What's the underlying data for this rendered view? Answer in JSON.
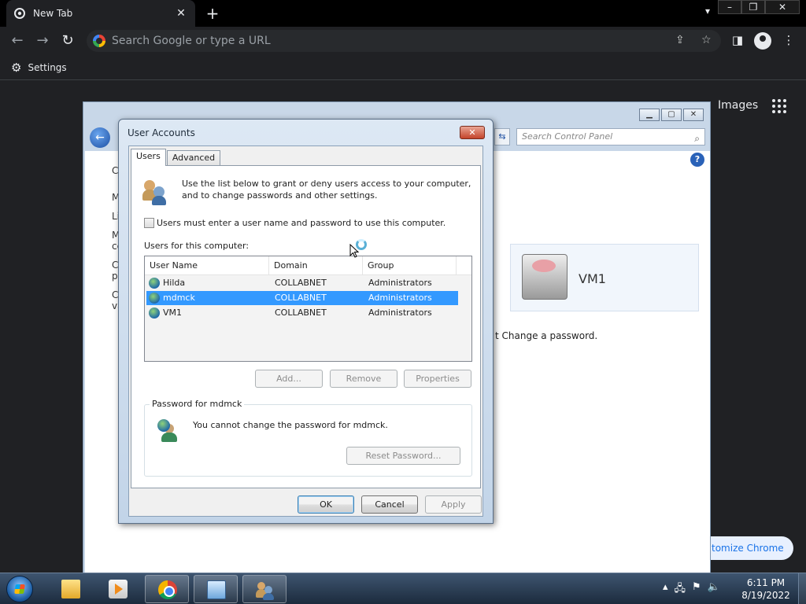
{
  "browser": {
    "tab_title": "New Tab",
    "tab_close": "✕",
    "new_tab": "+",
    "omnibox_placeholder": "Search Google or type a URL",
    "bookmark_settings": "Settings",
    "ntp_images": "Images",
    "customize_chrome": "tomize Chrome"
  },
  "control_panel": {
    "search_placeholder": "Search Control Panel",
    "left_fragments": [
      "C",
      "M",
      "Li",
      "M",
      "ce",
      "C",
      "pr",
      "C",
      "va"
    ],
    "vm1_label": "VM1",
    "change_password_link": "t Change a password."
  },
  "dialog": {
    "title": "User Accounts",
    "tabs": [
      "Users",
      "Advanced"
    ],
    "intro_text": "Use the list below to grant or deny users access to your computer, and to change passwords and other settings.",
    "must_enter_label": "Users must enter a user name and password to use this computer.",
    "users_for_computer_label": "Users for this computer:",
    "columns": [
      "User Name",
      "Domain",
      "Group"
    ],
    "users": [
      {
        "name": "Hilda",
        "domain": "COLLABNET",
        "group": "Administrators"
      },
      {
        "name": "mdmck",
        "domain": "COLLABNET",
        "group": "Administrators"
      },
      {
        "name": "VM1",
        "domain": "COLLABNET",
        "group": "Administrators"
      }
    ],
    "selected_user_index": 1,
    "buttons": {
      "add": "Add...",
      "remove": "Remove",
      "properties": "Properties"
    },
    "password_group_title": "Password for mdmck",
    "password_message": "You cannot change the password for mdmck.",
    "reset_password": "Reset Password...",
    "ok": "OK",
    "cancel": "Cancel",
    "apply": "Apply"
  },
  "taskbar": {
    "time": "6:11 PM",
    "date": "8/19/2022"
  }
}
